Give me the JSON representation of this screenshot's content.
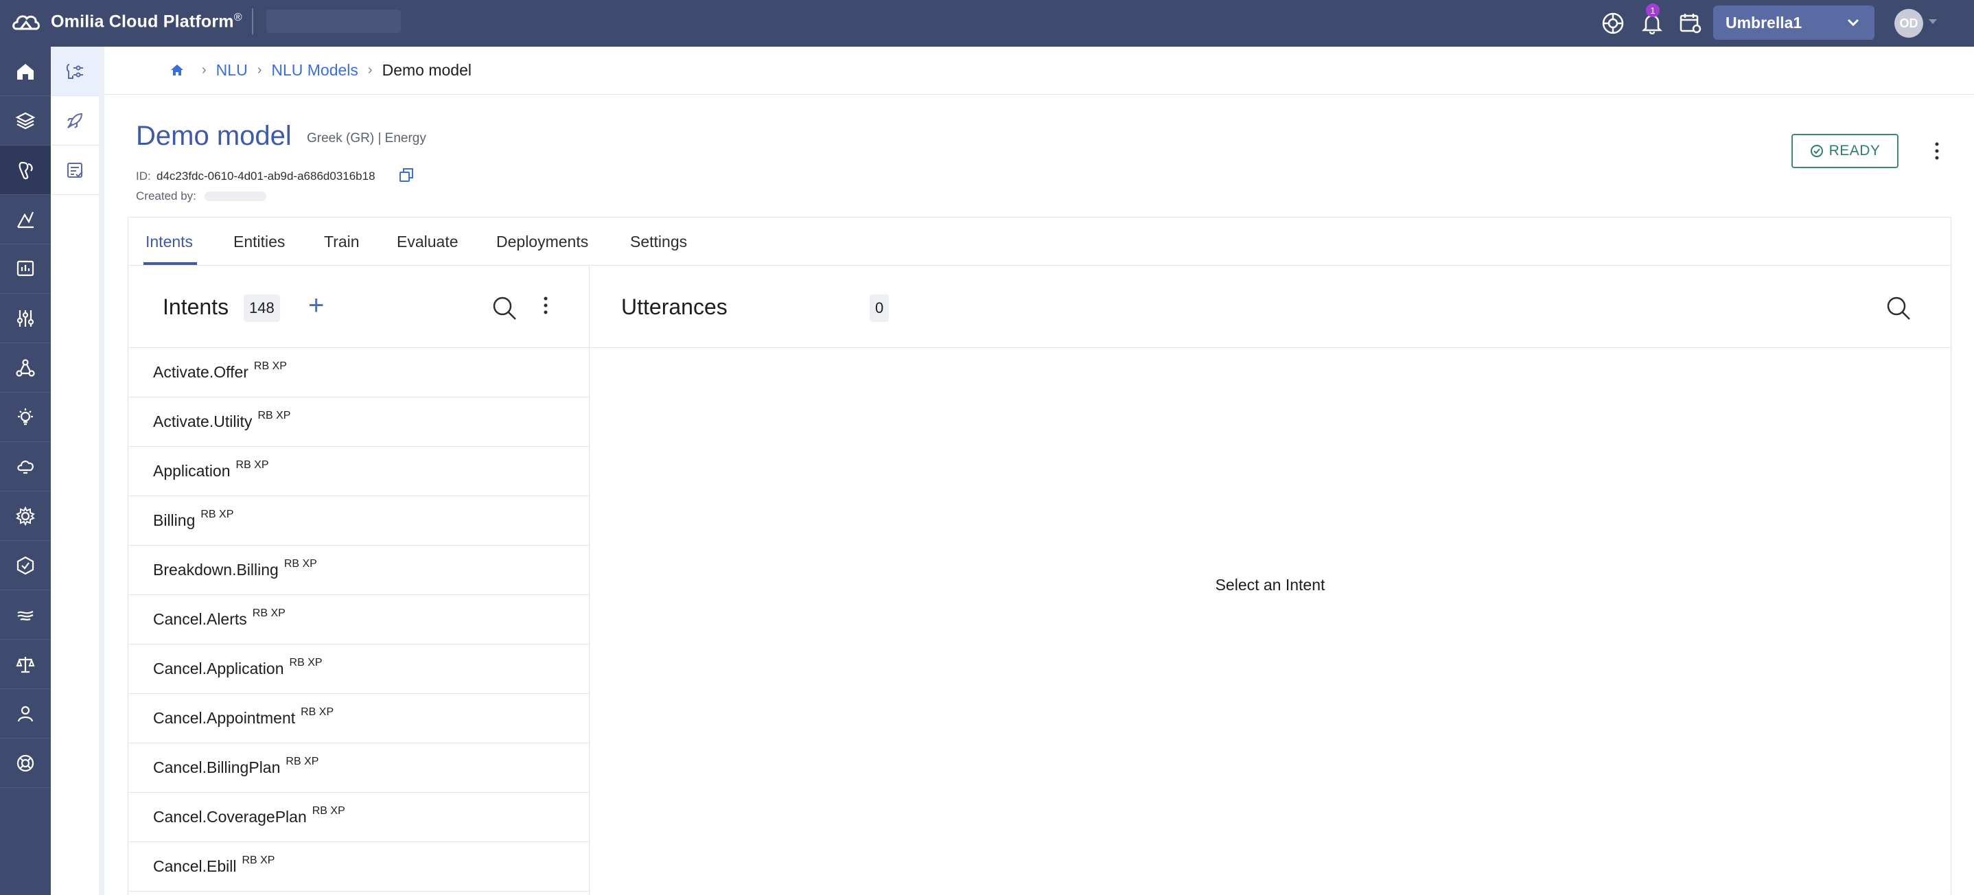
{
  "topbar": {
    "app_title": "Omilia Cloud Platform",
    "trademark": "®",
    "notifications_count": "1",
    "org_selector": "Umbrella1",
    "avatar_initials": "OD"
  },
  "breadcrumb": {
    "items": [
      "NLU",
      "NLU Models"
    ],
    "current": "Demo model"
  },
  "model": {
    "title": "Demo model",
    "subtitle": "Greek (GR) | Energy",
    "id_label": "ID:",
    "id": "d4c23fdc-0610-4d01-ab9d-a686d0316b18",
    "created_label": "Created by:",
    "status": "READY"
  },
  "tabs": [
    "Intents",
    "Entities",
    "Train",
    "Evaluate",
    "Deployments",
    "Settings"
  ],
  "intents": {
    "title": "Intents",
    "count": "148",
    "items": [
      {
        "name": "Activate.Offer",
        "tags": "RB XP"
      },
      {
        "name": "Activate.Utility",
        "tags": "RB XP"
      },
      {
        "name": "Application",
        "tags": "RB XP"
      },
      {
        "name": "Billing",
        "tags": "RB XP"
      },
      {
        "name": "Breakdown.Billing",
        "tags": "RB XP"
      },
      {
        "name": "Cancel.Alerts",
        "tags": "RB XP"
      },
      {
        "name": "Cancel.Application",
        "tags": "RB XP"
      },
      {
        "name": "Cancel.Appointment",
        "tags": "RB XP"
      },
      {
        "name": "Cancel.BillingPlan",
        "tags": "RB XP"
      },
      {
        "name": "Cancel.CoveragePlan",
        "tags": "RB XP"
      },
      {
        "name": "Cancel.Ebill",
        "tags": "RB XP"
      }
    ]
  },
  "utterances": {
    "title": "Utterances",
    "count": "0",
    "empty_message": "Select an Intent"
  },
  "colors": {
    "topbar": "#3f4b6e",
    "accent": "#3f5aa5",
    "link": "#3a6fd6",
    "ready": "#2f7d6d",
    "badge": "#a13fd4"
  },
  "icons": {
    "rail": [
      "home-icon",
      "layers-icon",
      "nlu-icon",
      "routing-icon",
      "analytics-icon",
      "sliders-icon",
      "network-icon",
      "bulb-icon",
      "cloud-icon",
      "gear-icon",
      "shield-icon",
      "speech-icon",
      "scale-icon",
      "user-icon",
      "lifebuoy-icon"
    ],
    "subrail": [
      "models-icon",
      "rocket-icon",
      "checklist-icon"
    ]
  }
}
